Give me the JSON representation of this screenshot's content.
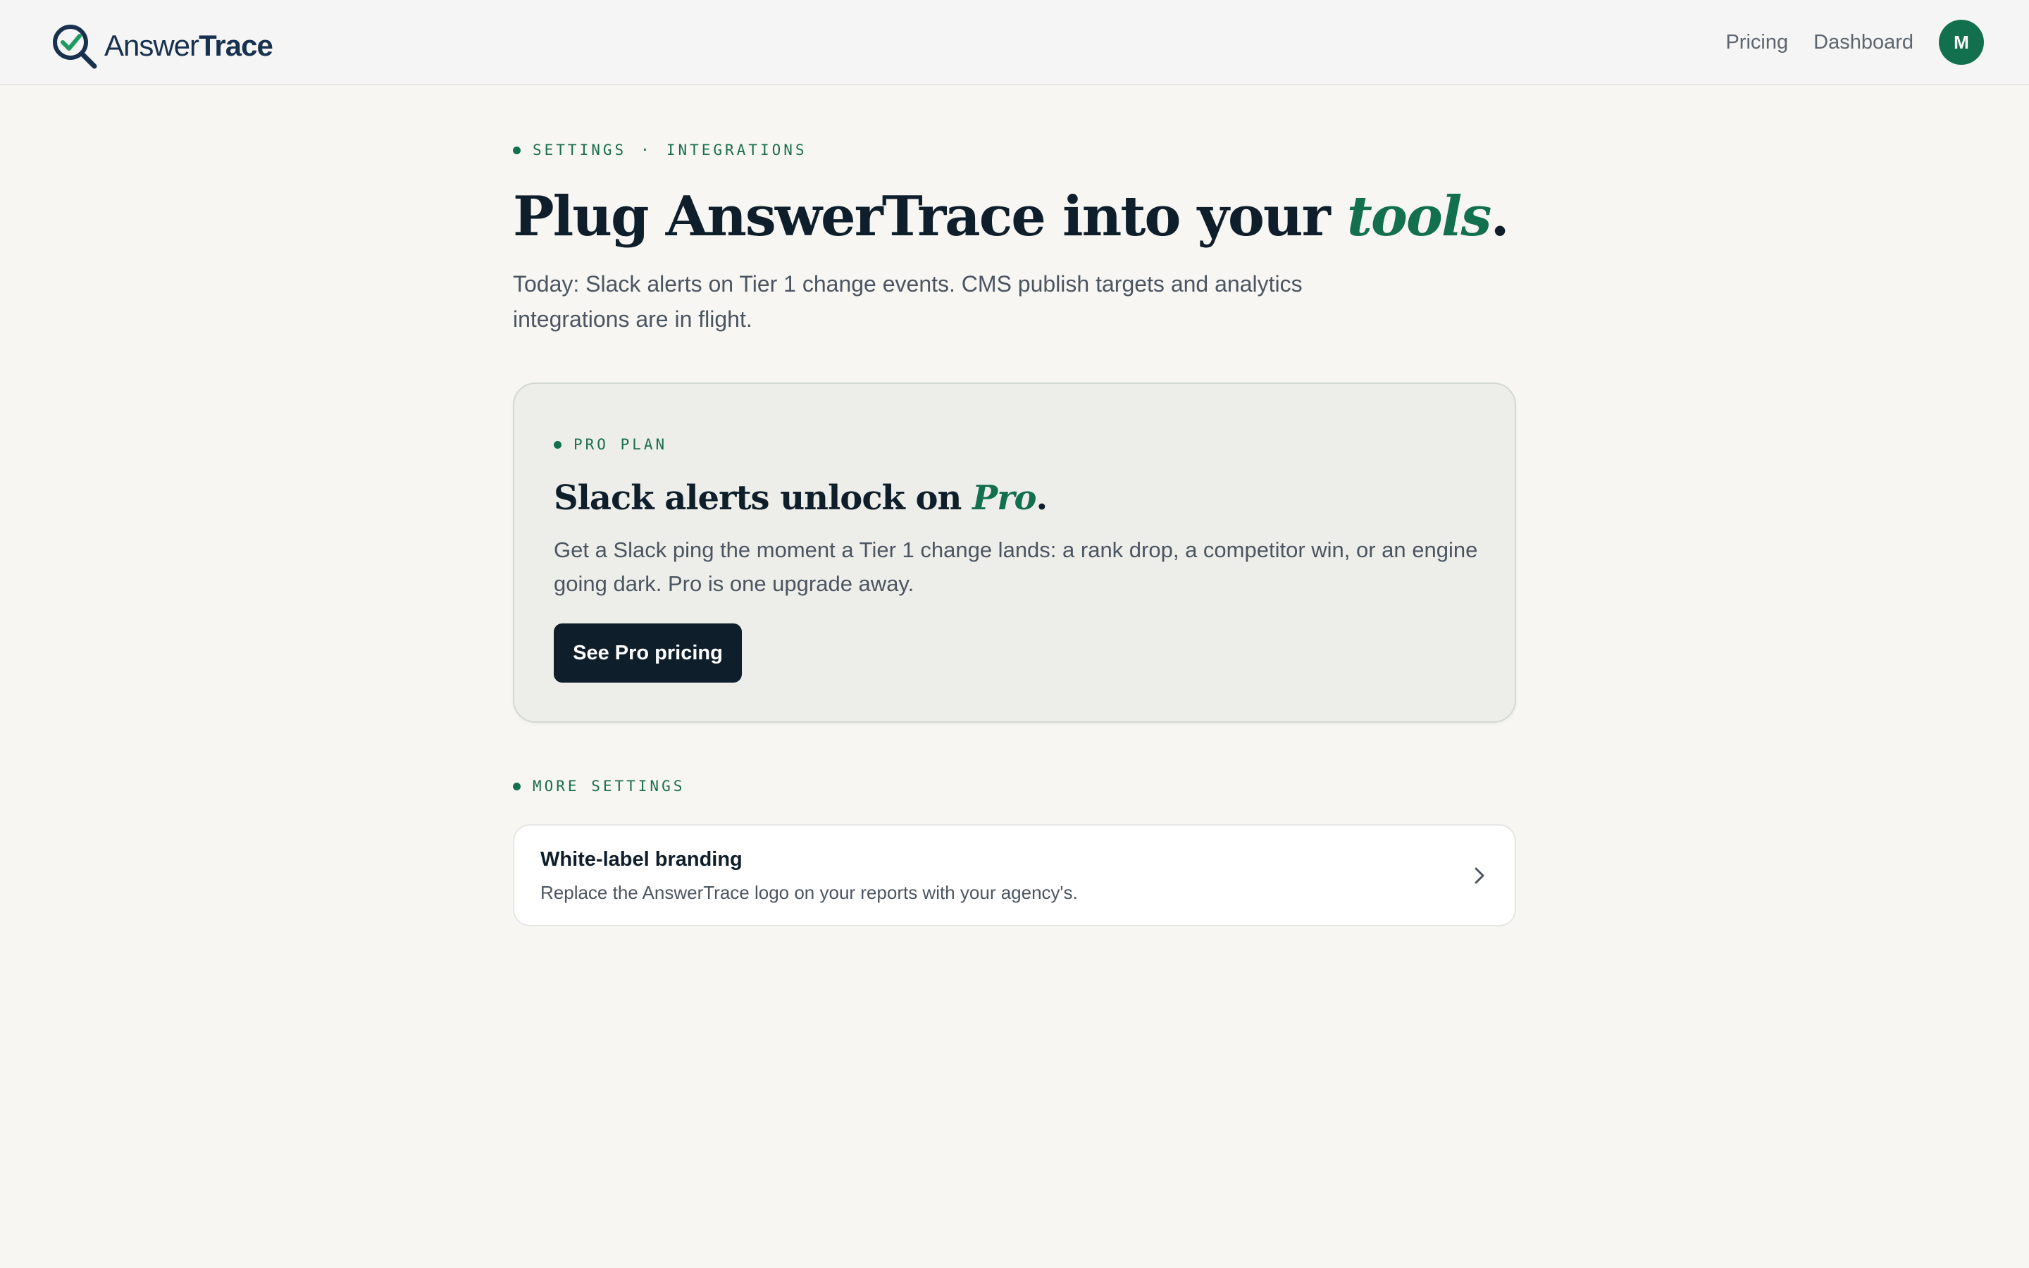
{
  "brand": {
    "name_light": "Answer",
    "name_bold": "Trace"
  },
  "nav": {
    "pricing": "Pricing",
    "dashboard": "Dashboard",
    "avatar_initial": "M"
  },
  "breadcrumb": {
    "section": "SETTINGS",
    "separator": "·",
    "page": "INTEGRATIONS"
  },
  "header": {
    "title_prefix": "Plug AnswerTrace into your",
    "title_accent": "tools",
    "title_suffix": ".",
    "intro": "Today: Slack alerts on Tier 1 change events. CMS publish targets and analytics integrations are in flight."
  },
  "pro_card": {
    "eyebrow": "PRO PLAN",
    "title_prefix": "Slack alerts unlock on",
    "title_accent": "Pro",
    "title_suffix": ".",
    "description": "Get a Slack ping the moment a Tier 1 change lands: a rank drop, a competitor win, or an engine going dark. Pro is one upgrade away.",
    "button_label": "See Pro pricing"
  },
  "more_settings": {
    "eyebrow": "MORE SETTINGS",
    "items": [
      {
        "title": "White-label branding",
        "description": "Replace the AnswerTrace logo on your reports with your agency's."
      }
    ]
  },
  "colors": {
    "accent": "#13704f",
    "ink": "#0f1e2b",
    "background": "#f7f6f3",
    "logo_blue": "#17314f"
  },
  "icons": {
    "logo": "magnifier-check-icon",
    "row": "chevron-right-icon"
  }
}
